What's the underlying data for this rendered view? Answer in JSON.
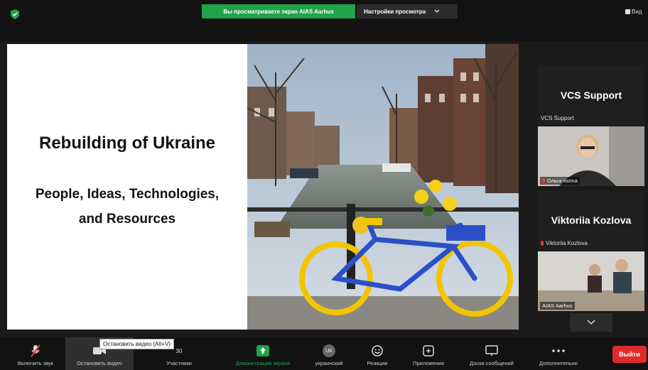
{
  "topbar": {
    "share_banner": "Вы просматриваете экран AIAS Aarhus",
    "view_options": "Настройки просмотра",
    "view_right": "Вид",
    "shield_color": "#21a34a"
  },
  "slide": {
    "title": "Rebuilding of Ukraine",
    "subtitle_line1": "People, Ideas, Technologies,",
    "subtitle_line2": "and Resources"
  },
  "participants": [
    {
      "name": "VCS Support",
      "label": "VCS Support",
      "video_label": "Ольга Iozina"
    },
    {
      "name": "Viktoriia Kozlova",
      "label": "Viktoriia Kozlova",
      "video_label": "AIAS Aarhus"
    }
  ],
  "toolbar": {
    "tooltip": "Остановить видео (Alt+V)",
    "unmute": "Включить звук",
    "stop_video": "Остановить видео",
    "participants": "Участники",
    "participants_count": "30",
    "share_screen": "Демонстрация экрана",
    "language": "украинский",
    "language_badge": "UK",
    "reactions": "Реакции",
    "apps": "Приложения",
    "whiteboards": "Доски сообщений",
    "more": "Дополнительно",
    "leave": "Выйти",
    "accent_green": "#21a34a",
    "leave_color": "#e02b2b"
  }
}
